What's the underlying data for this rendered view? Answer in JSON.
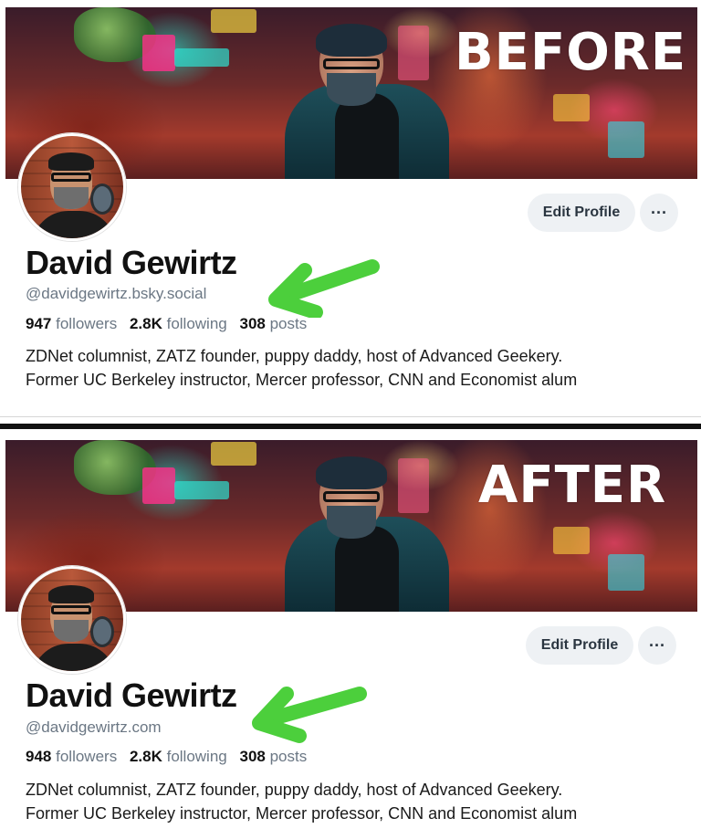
{
  "panels": [
    {
      "label": "BEFORE",
      "name": "David Gewirtz",
      "handle": "@davidgewirtz.bsky.social",
      "followers_count": "947",
      "followers_label": "followers",
      "following_count": "2.8K",
      "following_label": "following",
      "posts_count": "308",
      "posts_label": "posts",
      "bio_line1": "ZDNet columnist, ZATZ founder, puppy daddy, host of Advanced Geekery.",
      "bio_line2": "Former UC Berkeley instructor, Mercer professor, CNN and Economist alum",
      "edit_button": "Edit Profile",
      "more_button": "···"
    },
    {
      "label": "AFTER",
      "name": "David Gewirtz",
      "handle": "@davidgewirtz.com",
      "followers_count": "948",
      "followers_label": "followers",
      "following_count": "2.8K",
      "following_label": "following",
      "posts_count": "308",
      "posts_label": "posts",
      "bio_line1": "ZDNet columnist, ZATZ founder, puppy daddy, host of Advanced Geekery.",
      "bio_line2": "Former UC Berkeley instructor, Mercer professor, CNN and Economist alum",
      "edit_button": "Edit Profile",
      "more_button": "···"
    }
  ],
  "colors": {
    "arrow": "#4ccf3c",
    "name": "#111111",
    "muted": "#6b7784",
    "button_bg": "#eef1f4"
  },
  "icons": {
    "arrow": "green-arrow-icon",
    "more": "ellipsis-icon"
  }
}
